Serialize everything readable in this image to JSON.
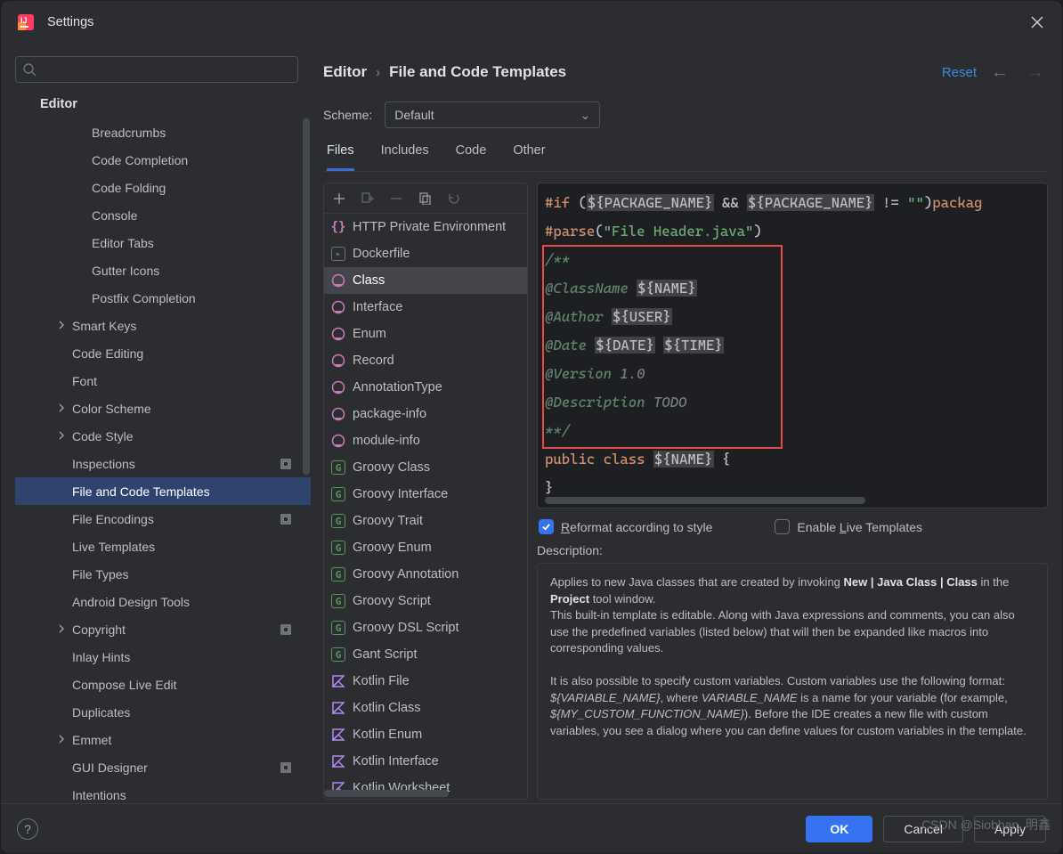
{
  "titlebar": {
    "title": "Settings"
  },
  "left": {
    "search_placeholder": "",
    "header": "Editor",
    "items": [
      {
        "label": "Breadcrumbs",
        "lvl": 2
      },
      {
        "label": "Code Completion",
        "lvl": 2
      },
      {
        "label": "Code Folding",
        "lvl": 2
      },
      {
        "label": "Console",
        "lvl": 2
      },
      {
        "label": "Editor Tabs",
        "lvl": 2
      },
      {
        "label": "Gutter Icons",
        "lvl": 2
      },
      {
        "label": "Postfix Completion",
        "lvl": 2
      },
      {
        "label": "Smart Keys",
        "lvl": 1,
        "arrow": true
      },
      {
        "label": "Code Editing",
        "lvl": 1
      },
      {
        "label": "Font",
        "lvl": 1
      },
      {
        "label": "Color Scheme",
        "lvl": 1,
        "arrow": true
      },
      {
        "label": "Code Style",
        "lvl": 1,
        "arrow": true
      },
      {
        "label": "Inspections",
        "lvl": 1,
        "badge": true
      },
      {
        "label": "File and Code Templates",
        "lvl": 1,
        "selected": true
      },
      {
        "label": "File Encodings",
        "lvl": 1,
        "badge": true
      },
      {
        "label": "Live Templates",
        "lvl": 1
      },
      {
        "label": "File Types",
        "lvl": 1
      },
      {
        "label": "Android Design Tools",
        "lvl": 1
      },
      {
        "label": "Copyright",
        "lvl": 1,
        "arrow": true,
        "badge": true
      },
      {
        "label": "Inlay Hints",
        "lvl": 1
      },
      {
        "label": "Compose Live Edit",
        "lvl": 1
      },
      {
        "label": "Duplicates",
        "lvl": 1
      },
      {
        "label": "Emmet",
        "lvl": 1,
        "arrow": true
      },
      {
        "label": "GUI Designer",
        "lvl": 1,
        "badge": true
      },
      {
        "label": "Intentions",
        "lvl": 1
      }
    ]
  },
  "breadcrumbs": {
    "root": "Editor",
    "page": "File and Code Templates",
    "reset": "Reset"
  },
  "scheme": {
    "label": "Scheme:",
    "value": "Default"
  },
  "tabs": [
    "Files",
    "Includes",
    "Code",
    "Other"
  ],
  "templates": [
    {
      "label": "HTTP Private Environment",
      "icon": "http"
    },
    {
      "label": "Dockerfile",
      "icon": "docker"
    },
    {
      "label": "Class",
      "icon": "java",
      "selected": true
    },
    {
      "label": "Interface",
      "icon": "java"
    },
    {
      "label": "Enum",
      "icon": "java"
    },
    {
      "label": "Record",
      "icon": "java"
    },
    {
      "label": "AnnotationType",
      "icon": "java"
    },
    {
      "label": "package-info",
      "icon": "java"
    },
    {
      "label": "module-info",
      "icon": "java"
    },
    {
      "label": "Groovy Class",
      "icon": "groovy"
    },
    {
      "label": "Groovy Interface",
      "icon": "groovy"
    },
    {
      "label": "Groovy Trait",
      "icon": "groovy"
    },
    {
      "label": "Groovy Enum",
      "icon": "groovy"
    },
    {
      "label": "Groovy Annotation",
      "icon": "groovy"
    },
    {
      "label": "Groovy Script",
      "icon": "groovy"
    },
    {
      "label": "Groovy DSL Script",
      "icon": "groovy"
    },
    {
      "label": "Gant Script",
      "icon": "groovy"
    },
    {
      "label": "Kotlin File",
      "icon": "kotlin"
    },
    {
      "label": "Kotlin Class",
      "icon": "kotlin"
    },
    {
      "label": "Kotlin Enum",
      "icon": "kotlin"
    },
    {
      "label": "Kotlin Interface",
      "icon": "kotlin"
    },
    {
      "label": "Kotlin Worksheet",
      "icon": "kotlin"
    }
  ],
  "editor": {
    "line1": {
      "if": "#if",
      "open": " (",
      "v1": "${PACKAGE_NAME}",
      "amp": " && ",
      "v2": "${PACKAGE_NAME}",
      "rest1": " != ",
      "empty": "\"\"",
      "rest2": ")",
      "pkg": "packag"
    },
    "line2": {
      "parse": "#parse",
      "open": "(",
      "str": "\"File Header.java\"",
      "close": ")"
    },
    "comment": {
      "open": "/**",
      "l1a": "@ClassName ",
      "l1b": "${NAME}",
      "l2a": "@Author ",
      "l2b": "${USER}",
      "l3a": "@Date ",
      "l3b": "${DATE}",
      "l3c": " ",
      "l3d": "${TIME}",
      "l4a": "@Version ",
      "l4b": "1.0",
      "l5a": "@Description ",
      "l5b": "TODO",
      "close": "**/"
    },
    "decl": {
      "a": "public class ",
      "b": "${NAME}",
      "c": " {"
    },
    "end": "}"
  },
  "checks": {
    "reformat_pre": "R",
    "reformat": "eformat according to style",
    "live_pre": "Enable ",
    "live_u": "L",
    "live": "ive Templates"
  },
  "desc": {
    "head": "Description:",
    "p1a": "Applies to new Java classes that are created by invoking ",
    "p1b": "New | Java Class | Class",
    "p1c": " in the ",
    "p1d": "Project",
    "p1e": " tool window.",
    "p2": "This built-in template is editable. Along with Java expressions and comments, you can also use the predefined variables (listed below) that will then be expanded like macros into corresponding values.",
    "p3a": "It is also possible to specify custom variables. Custom variables use the following format: ",
    "p3b": "${VARIABLE_NAME}",
    "p3c": ", where ",
    "p3d": "VARIABLE_NAME",
    "p3e": " is a name for your variable (for example, ",
    "p3f": "${MY_CUSTOM_FUNCTION_NAME}",
    "p3g": "). Before the IDE creates a new file with custom variables, you see a dialog where you can define values for custom variables in the template."
  },
  "footer": {
    "ok": "OK",
    "cancel": "Cancel",
    "apply": "Apply"
  },
  "watermark": "CSDN @Siobhan. 明鑫"
}
